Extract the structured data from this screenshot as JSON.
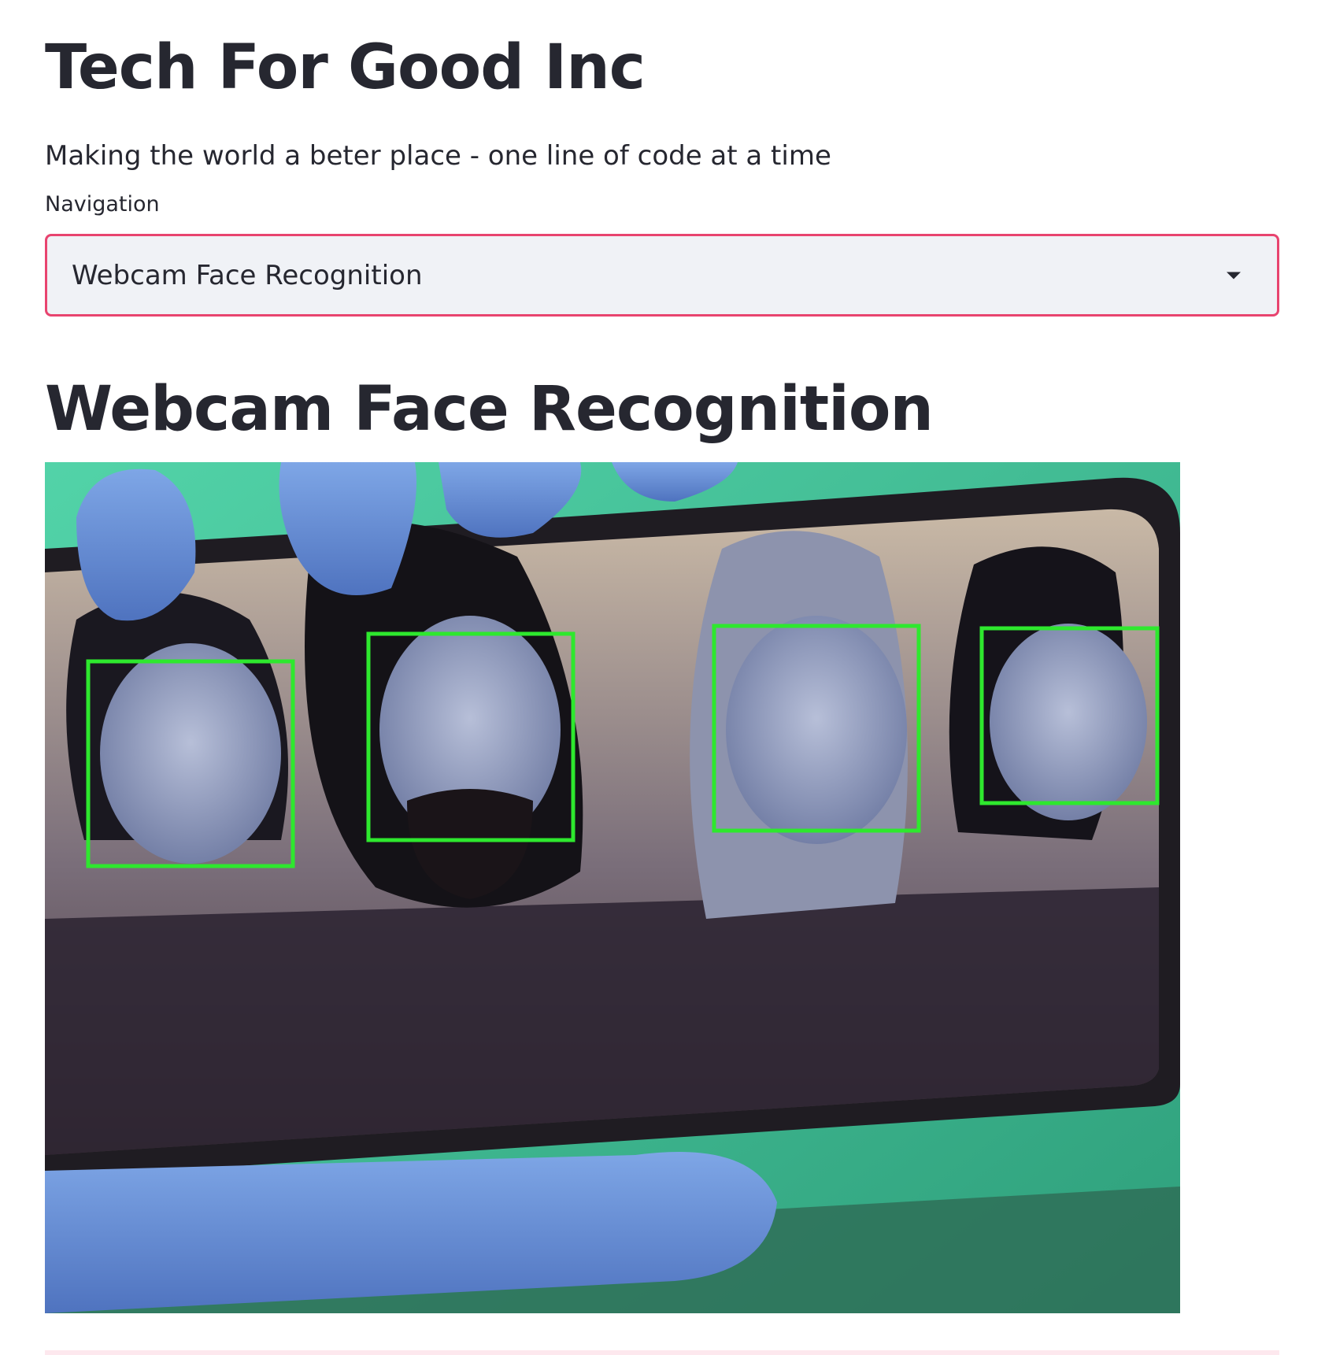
{
  "header": {
    "title": "Tech For Good Inc",
    "tagline": "Making the world a beter place - one line of code at a time"
  },
  "navigation": {
    "label": "Navigation",
    "selected": "Webcam Face Recognition",
    "icon": "chevron-down-icon",
    "accent_color": "#e8446f"
  },
  "main": {
    "section_title": "Webcam Face Recognition",
    "webcam_feed": {
      "detected_faces": 4,
      "box_color": "#2ee82e"
    }
  }
}
